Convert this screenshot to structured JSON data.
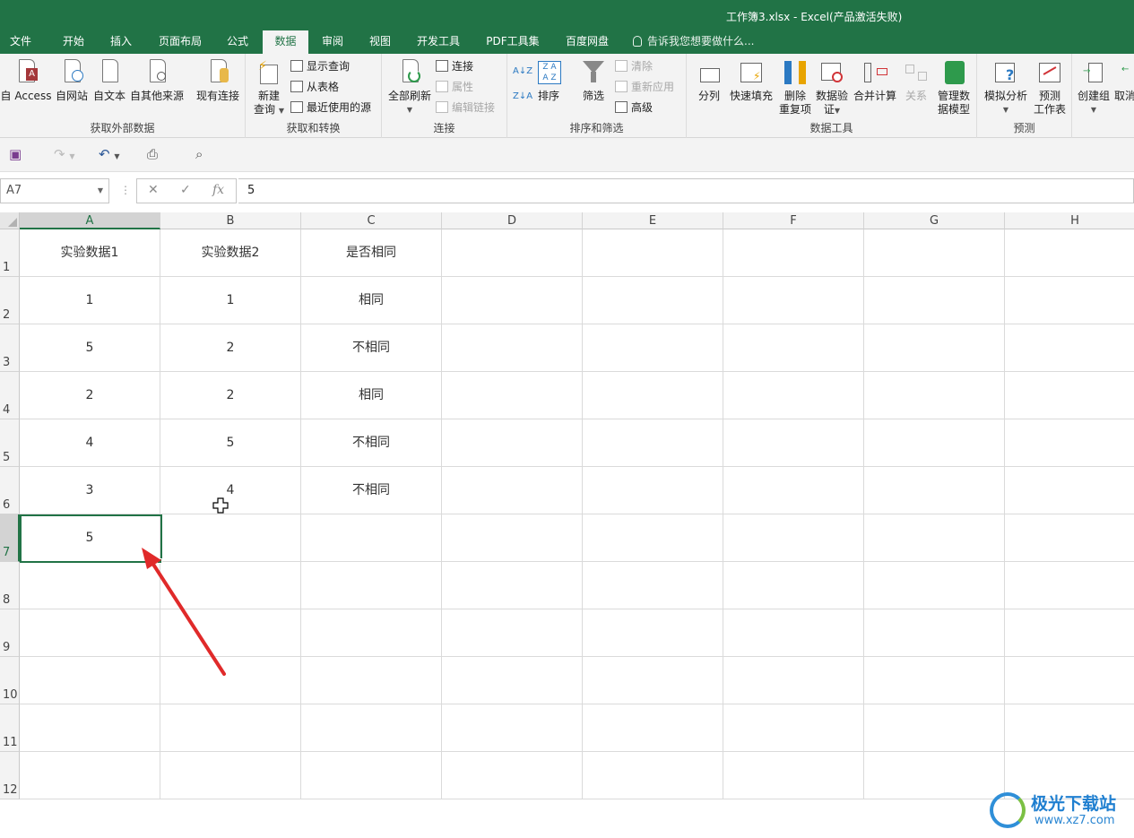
{
  "window": {
    "title": "工作簿3.xlsx - Excel(产品激活失败)"
  },
  "tabs": [
    "文件",
    "开始",
    "插入",
    "页面布局",
    "公式",
    "数据",
    "审阅",
    "视图",
    "开发工具",
    "PDF工具集",
    "百度网盘"
  ],
  "active_tab": "数据",
  "tell_me": "告诉我您想要做什么...",
  "ribbon": {
    "get_external": {
      "label": "获取外部数据",
      "buttons": [
        "自 Access",
        "自网站",
        "自文本",
        "自其他来源",
        "现有连接"
      ]
    },
    "get_transform": {
      "label": "获取和转换",
      "new_query": "新建",
      "new_query_2": "查询",
      "show_query": "显示查询",
      "from_table": "从表格",
      "recent_sources": "最近使用的源"
    },
    "connections": {
      "label": "连接",
      "refresh_all": "全部刷新",
      "connections": "连接",
      "properties": "属性",
      "edit_links": "编辑链接"
    },
    "sort_filter": {
      "label": "排序和筛选",
      "sort": "排序",
      "filter": "筛选",
      "clear": "清除",
      "reapply": "重新应用",
      "advanced": "高级"
    },
    "data_tools": {
      "label": "数据工具",
      "split": "分列",
      "flash_fill": "快速填充",
      "remove_dup_1": "删除",
      "remove_dup_2": "重复项",
      "validation_1": "数据验",
      "validation_2": "证",
      "consolidate": "合并计算",
      "relations": "关系",
      "data_model_1": "管理数",
      "data_model_2": "据模型"
    },
    "forecast": {
      "label": "预测",
      "whatif": "模拟分析",
      "sheet_1": "预测",
      "sheet_2": "工作表"
    },
    "outline": {
      "group": "创建组",
      "ungroup": "取消"
    }
  },
  "formula_bar": {
    "name_box": "A7",
    "fx": "fx",
    "value": "5"
  },
  "columns": [
    "A",
    "B",
    "C",
    "D",
    "E",
    "F",
    "G",
    "H"
  ],
  "rows": [
    "1",
    "2",
    "3",
    "4",
    "5",
    "6",
    "7",
    "8",
    "9",
    "10",
    "11",
    "12"
  ],
  "cells": [
    [
      "实验数据1",
      "实验数据2",
      "是否相同"
    ],
    [
      "1",
      "1",
      "相同"
    ],
    [
      "5",
      "2",
      "不相同"
    ],
    [
      "2",
      "2",
      "相同"
    ],
    [
      "4",
      "5",
      "不相同"
    ],
    [
      "3",
      "4",
      "不相同"
    ],
    [
      "5",
      "",
      ""
    ]
  ],
  "selected_cell": "A7",
  "watermark": {
    "name": "极光下载站",
    "url": "www.xz7.com"
  },
  "colors": {
    "excel_green": "#217346",
    "arrow": "#e02a2a"
  }
}
